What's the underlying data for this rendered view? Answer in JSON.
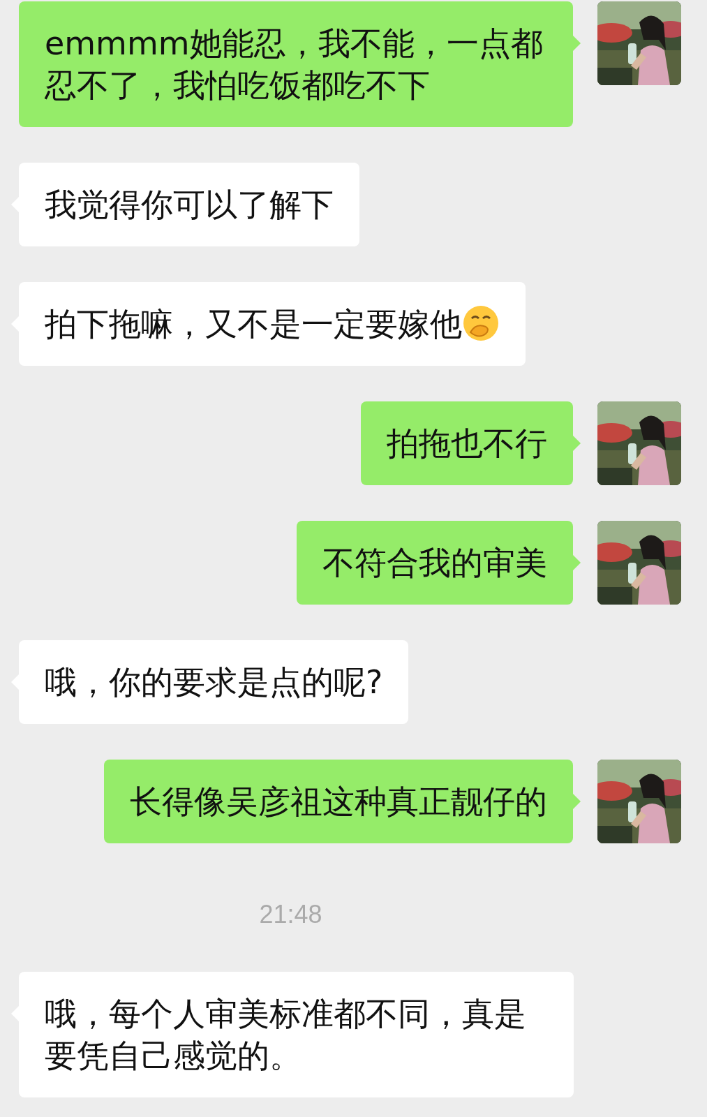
{
  "messages": [
    {
      "kind": "sent",
      "text": "emmmm她能忍，我不能，一点都忍不了，我怕吃饭都吃不下"
    },
    {
      "kind": "received",
      "text": "我觉得你可以了解下"
    },
    {
      "kind": "received",
      "text": "拍下拖嘛，又不是一定要嫁他",
      "emoji": true
    },
    {
      "kind": "sent",
      "text": "拍拖也不行"
    },
    {
      "kind": "sent",
      "text": "不符合我的审美"
    },
    {
      "kind": "received",
      "text": "哦，你的要求是点的呢?"
    },
    {
      "kind": "sent",
      "text": "长得像吴彦祖这种真正靓仔的"
    },
    {
      "kind": "time",
      "text": "21:48"
    },
    {
      "kind": "received",
      "text": "哦，每个人审美标准都不同，真是要凭自己感觉的。"
    }
  ]
}
